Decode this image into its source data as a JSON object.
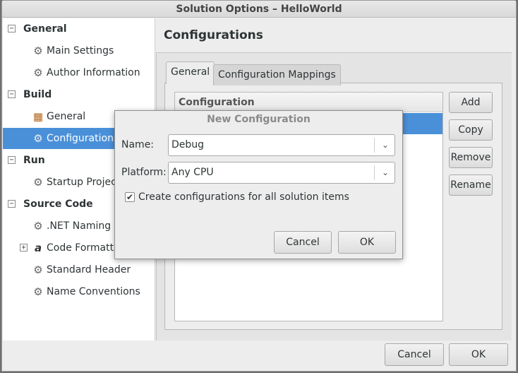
{
  "window": {
    "title": "Solution Options – HelloWorld"
  },
  "sidebar": {
    "rows": [
      {
        "kind": "category",
        "label": "General",
        "expander": "⊟"
      },
      {
        "kind": "item",
        "label": "Main Settings",
        "icon": "gear-icon"
      },
      {
        "kind": "item",
        "label": "Author Information",
        "icon": "gear-icon"
      },
      {
        "kind": "category",
        "label": "Build",
        "expander": "⊟"
      },
      {
        "kind": "item",
        "label": "General",
        "icon": "build-icon"
      },
      {
        "kind": "item",
        "label": "Configurations",
        "icon": "gear-icon",
        "selected": true
      },
      {
        "kind": "category",
        "label": "Run",
        "expander": "⊟"
      },
      {
        "kind": "item",
        "label": "Startup Project",
        "icon": "gear-icon"
      },
      {
        "kind": "category",
        "label": "Source Code",
        "expander": "⊟"
      },
      {
        "kind": "item",
        "label": ".NET Naming Policies",
        "icon": "gear-icon"
      },
      {
        "kind": "item",
        "label": "Code Formatting",
        "icon": "code-format-icon",
        "expander": "⊞"
      },
      {
        "kind": "item",
        "label": "Standard Header",
        "icon": "gear-icon"
      },
      {
        "kind": "item",
        "label": "Name Conventions",
        "icon": "gear-icon"
      }
    ]
  },
  "main": {
    "title": "Configurations",
    "tabs": [
      {
        "label": "General",
        "active": true
      },
      {
        "label": "Configuration Mappings",
        "active": false
      }
    ],
    "list_header": "Configuration",
    "side_buttons": [
      "Add",
      "Copy",
      "Remove",
      "Rename"
    ]
  },
  "footer": {
    "cancel_label": "Cancel",
    "ok_label": "OK"
  },
  "dialog": {
    "title": "New Configuration",
    "name_label": "Name:",
    "name_value": "Debug",
    "platform_label": "Platform:",
    "platform_value": "Any CPU",
    "checkbox_checked": true,
    "checkbox_label": "Create configurations for all solution items",
    "cancel_label": "Cancel",
    "ok_label": "OK"
  },
  "colors": {
    "selection": "#4a90d9",
    "window_bg": "#ededed"
  }
}
